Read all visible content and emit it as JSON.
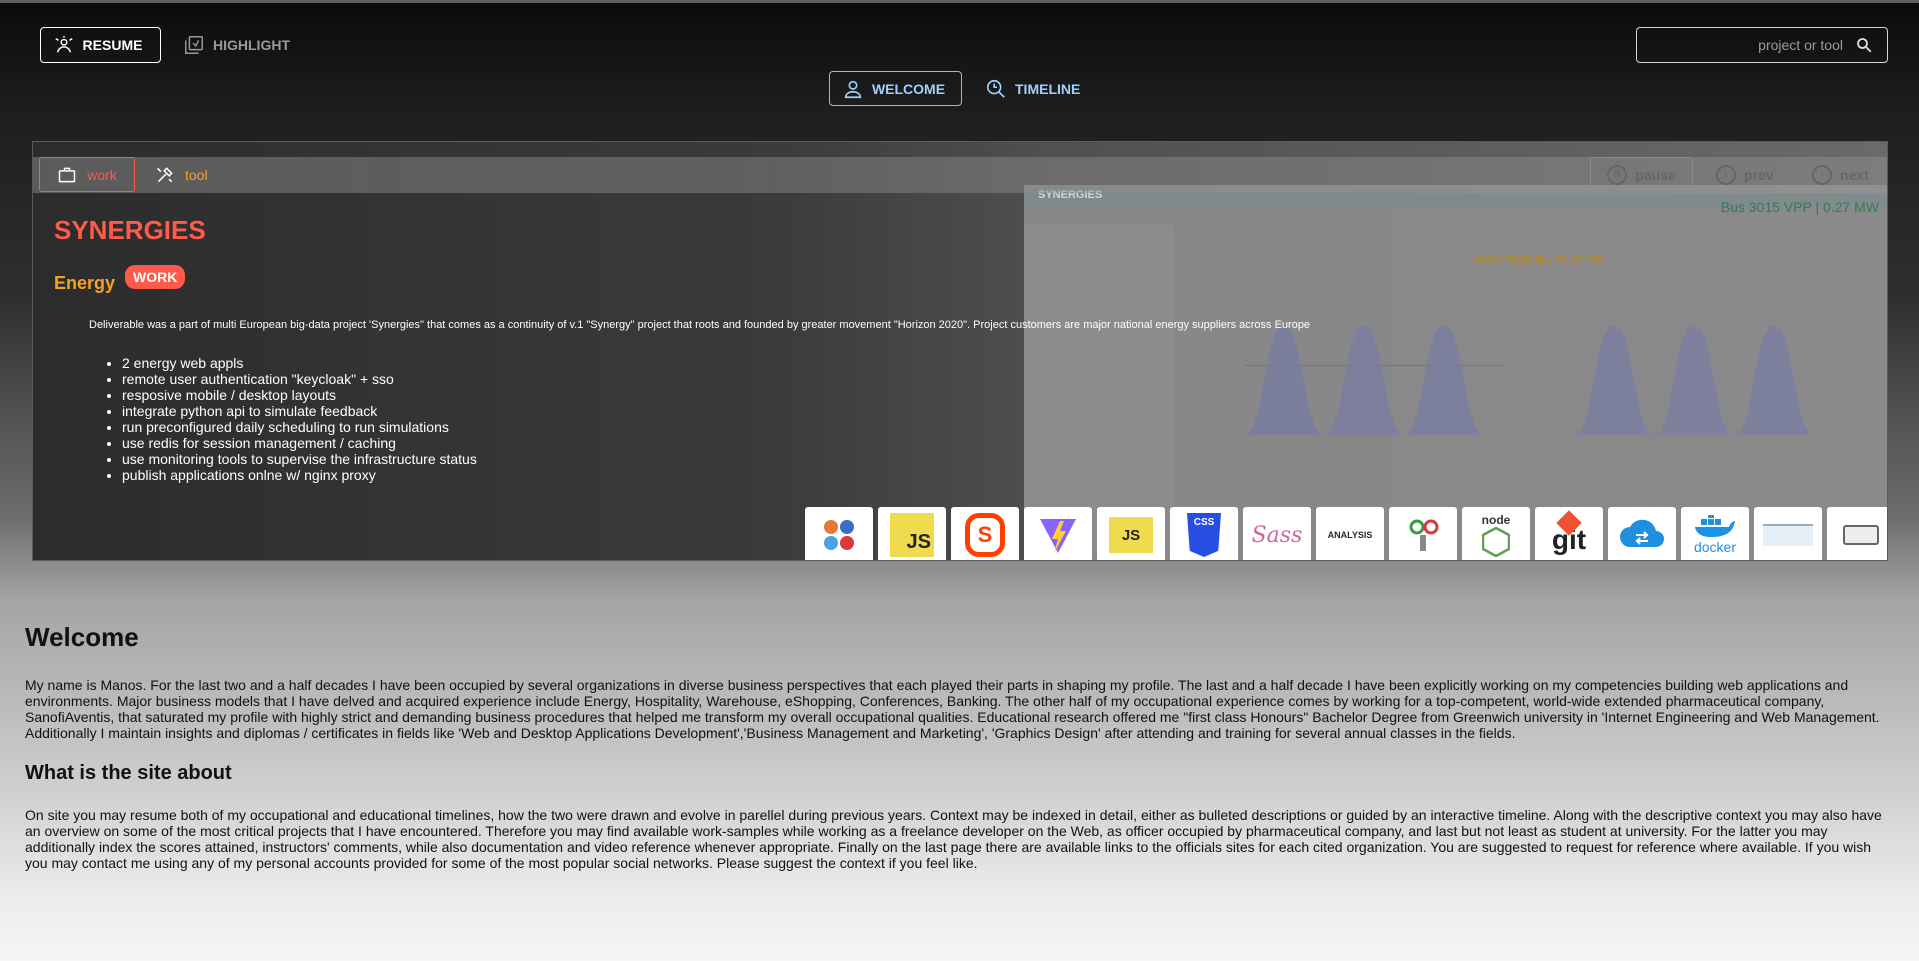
{
  "header": {
    "resume_label": "RESUME",
    "highlight_label": "HIGHLIGHT",
    "search_placeholder": "project or tool"
  },
  "subnav": {
    "welcome_label": "WELCOME",
    "timeline_label": "TIMELINE"
  },
  "showcase": {
    "tabs": {
      "work": "work",
      "tool": "tool"
    },
    "controls": {
      "pause": "pause",
      "prev": "prev",
      "next": "next"
    },
    "project": {
      "title": "SYNERGIES",
      "domain": "Energy",
      "badge": "WORK",
      "description": "Deliverable was a part of multi European big-data project 'Synergies\" that comes as a continuity of v.1 \"Synergy\" project that roots and founded by greater movement \"Horizon 2020\". Project customers are major national energy suppliers across Europe",
      "bullets": [
        "2 energy web appls",
        "remote user authentication \"keycloak\" + sso",
        "resposive mobile / desktop layouts",
        "integrate python api to simulate feedback",
        "run preconfigured daily scheduling to run simulations",
        "use redis for session management / caching",
        "use monitoring tools to supervise the infrastructure status",
        "publish applications onlne w/ nginx proxy"
      ],
      "screenshot": {
        "kpi": "Bus 3015 VPP | 0.27 MW",
        "chart_title": "ASSET FLEXIBILITY OFFER",
        "brand": "SYNERGIES"
      },
      "tools": [
        {
          "name": "browsers-icon",
          "label": ""
        },
        {
          "name": "javascript-icon",
          "label": "JS"
        },
        {
          "name": "svelte-icon",
          "label": "S"
        },
        {
          "name": "vite-icon",
          "label": "V"
        },
        {
          "name": "es6-icon",
          "label": "JS"
        },
        {
          "name": "css3-icon",
          "label": "CSS"
        },
        {
          "name": "sass-icon",
          "label": "Sass"
        },
        {
          "name": "analysis-icon",
          "label": "ANALYSIS"
        },
        {
          "name": "testing-icon",
          "label": ""
        },
        {
          "name": "nodejs-icon",
          "label": "node"
        },
        {
          "name": "git-icon",
          "label": "git"
        },
        {
          "name": "cloud-icon",
          "label": ""
        },
        {
          "name": "docker-icon",
          "label": "docker"
        },
        {
          "name": "nginx-icon",
          "label": ""
        },
        {
          "name": "keycloak-icon",
          "label": ""
        }
      ]
    }
  },
  "welcome": {
    "heading": "Welcome",
    "text": "My name is Manos. For the last two and a half decades I have been occupied by several organizations in diverse business perspectives that each played their parts in shaping my profile. The last and a half decade I have been explicitly working on my competencies building web applications and environments. Major business models that I have delved and acquired experience include Energy, Hospitality, Warehouse, eShopping, Conferences, Banking. The other half of my occupational experience comes by working for a top-competent, world-wide extended pharmaceutical company, SanofiAventis, that saturated my profile with highly strict and demanding business procedures that helped me transform my overall occupational qualities. Educational research offered me \"first class Honours\" Bachelor Degree from Greenwich university in 'Internet Engineering and Web Management. Additionally I maintain insights and diplomas / certificates in fields like 'Web and Desktop Applications Development','Business Management and Marketing', 'Graphics Design' after attending and training for several annual classes in the fields."
  },
  "about": {
    "heading": "What is the site about",
    "text": "On site you may resume both of my occupational and educational timelines, how the two were drawn and evolve in parellel during previous years. Context may be indexed in detail, either as bulleted descriptions or guided by an interactive timeline. Along with the descriptive context you may also have an overview on some of the most critical projects that I have encountered. Therefore you may find available work-samples while working as a freelance developer on the Web, as officer occupied by pharmaceutical company, and last but not least as student at university. For the latter you may additionally index the scores attained, instructors' comments, while also documentation and video reference whenever appropriate. Finally on the last page there are available links to the officials sites for each cited organization. You are suggested to request for reference where available. If you wish you may contact me using any of my personal accounts provided for some of the most popular social networks. Please suggest the context if you feel like."
  },
  "colors": {
    "accent_work": "#ff5a4a",
    "accent_tool": "#f3a224",
    "accent_nav": "#9fd1ff"
  }
}
